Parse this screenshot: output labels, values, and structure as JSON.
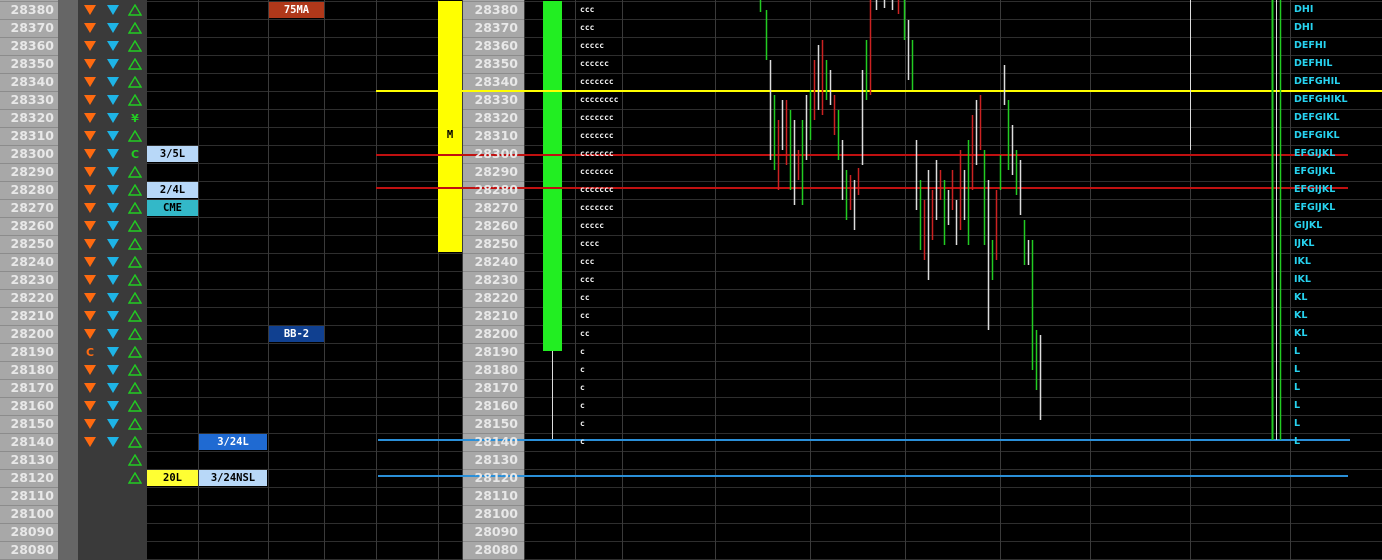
{
  "prices": [
    "28380",
    "28370",
    "28360",
    "28350",
    "28340",
    "28330",
    "28320",
    "28310",
    "28300",
    "28290",
    "28280",
    "28270",
    "28260",
    "28250",
    "28240",
    "28230",
    "28220",
    "28210",
    "28200",
    "28190",
    "28180",
    "28170",
    "28160",
    "28150",
    "28140",
    "28130",
    "28120",
    "28110",
    "28100",
    "28090",
    "28080"
  ],
  "tpo_profile": [
    "ccc",
    "ccc",
    "ccccc",
    "cccccc",
    "ccccccc",
    "cccccccc",
    "ccccccc",
    "ccccccc",
    "ccccccc",
    "ccccccc",
    "ccccccc",
    "ccccccc",
    "ccccc",
    "cccc",
    "ccc",
    "ccc",
    "cc",
    "cc",
    "cc",
    "c",
    "c",
    "c",
    "c",
    "c",
    "c",
    "",
    "",
    "",
    "",
    "",
    ""
  ],
  "period_letters": [
    "DHI",
    "DHI",
    "DEFHI",
    "DEFHIL",
    "DEFGHIL",
    "DEFGHIKL",
    "DEFGIKL",
    "DEFGIKL",
    "EFGIJKL",
    "EFGIJKL",
    "EFGIJKL",
    "EFGIJKL",
    "GIJKL",
    "IJKL",
    "IKL",
    "IKL",
    "KL",
    "KL",
    "KL",
    "L",
    "L",
    "L",
    "L",
    "L",
    "L",
    "",
    "",
    "",
    "",
    "",
    ""
  ],
  "column_a": [
    "down",
    "down",
    "down",
    "down",
    "down",
    "down",
    "down",
    "down",
    "down",
    "down",
    "down",
    "down",
    "down",
    "down",
    "down",
    "down",
    "down",
    "down",
    "down",
    "C",
    "down",
    "down",
    "down",
    "down",
    "down",
    "",
    "",
    "",
    "",
    "",
    ""
  ],
  "column_b": [
    "down",
    "down",
    "down",
    "down",
    "down",
    "down",
    "down",
    "down",
    "down",
    "down",
    "down",
    "down",
    "down",
    "down",
    "down",
    "down",
    "down",
    "down",
    "down",
    "down",
    "down",
    "down",
    "down",
    "down",
    "down",
    "",
    "",
    "",
    "",
    "",
    ""
  ],
  "column_c": [
    "up",
    "up",
    "up",
    "up",
    "up",
    "up",
    "¥",
    "up",
    "C",
    "up",
    "up",
    "up",
    "up",
    "up",
    "up",
    "up",
    "up",
    "up",
    "up",
    "up",
    "up",
    "up",
    "up",
    "up",
    "up",
    "up",
    "up",
    "",
    "",
    "",
    ""
  ],
  "labels": [
    {
      "row": 0,
      "col": "ma",
      "text": "75MA",
      "color": "#b0381a",
      "text_color": "#ffffff"
    },
    {
      "row": 8,
      "col": "d",
      "text": "3/5L",
      "color": "#b8d8f8",
      "text_color": "#000000"
    },
    {
      "row": 10,
      "col": "d",
      "text": "2/4L",
      "color": "#b8d8f8",
      "text_color": "#000000"
    },
    {
      "row": 11,
      "col": "d",
      "text": "CME",
      "color": "#33b8c8",
      "text_color": "#000000"
    },
    {
      "row": 18,
      "col": "ma",
      "text": "BB-2",
      "color": "#104090",
      "text_color": "#ffffff"
    },
    {
      "row": 24,
      "col": "e",
      "text": "3/24L",
      "color": "#1f6ad2",
      "text_color": "#ffffff"
    },
    {
      "row": 26,
      "col": "d",
      "text": "20L",
      "color": "#ffff33",
      "text_color": "#000000"
    },
    {
      "row": 26,
      "col": "e",
      "text": "3/24NSL",
      "color": "#b8d8f8",
      "text_color": "#000000"
    }
  ],
  "yellow_bar_marker": "M",
  "colors": {
    "up": "#22cc22",
    "down": "#ff6a10",
    "down_cyan": "#1eb4e6",
    "yellow": "#ffff00",
    "green": "#22ee22",
    "red_line": "#c01010",
    "blue_line": "#2a8fd8"
  }
}
